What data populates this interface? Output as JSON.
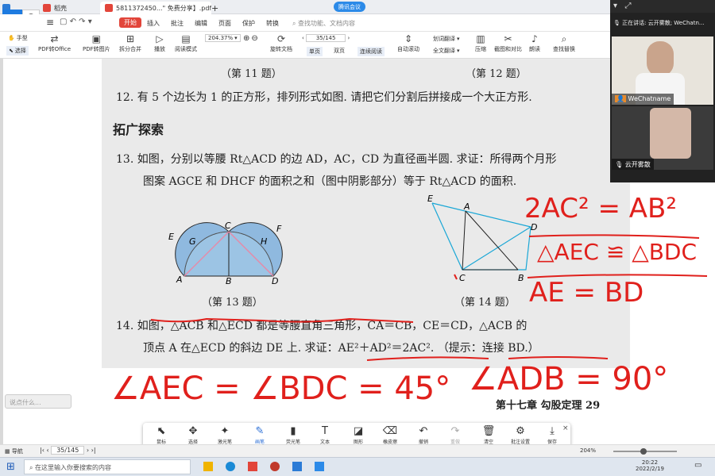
{
  "tabs": [
    {
      "label": "稻壳"
    },
    {
      "label": "5811372450...\" 免费分享】.pdf"
    }
  ],
  "meeting_badge": "腾讯会议",
  "menu": {
    "start": "开始",
    "items": [
      "插入",
      "批注",
      "编辑",
      "页面",
      "保护",
      "转换"
    ],
    "search_placeholder": "查找功能、文档内容"
  },
  "toolbar": {
    "hand": "手型",
    "select": "选择",
    "pdf_office": "PDF转Office",
    "pdf_image": "PDF转图片",
    "split_merge": "拆分合并",
    "play": "播放",
    "read_mode": "阅读模式",
    "zoom": "204.37%",
    "page_box": "35/145",
    "rotate": "旋转文档",
    "single": "单页",
    "double": "双页",
    "continuous": "连续阅读",
    "auto_scroll": "自动滚动",
    "translate": "划词翻译",
    "full_translate": "全文翻译",
    "compress": "压缩",
    "screenshot": "截图和对比",
    "read_aloud": "朗读",
    "find_replace": "查找替换"
  },
  "doc": {
    "cap11": "（第 11 题）",
    "cap12": "（第 12 题）",
    "q12": "12. 有 5 个边长为 1 的正方形，排列形式如图. 请把它们分割后拼接成一个大正方形.",
    "section": "拓广探索",
    "q13a": "13. 如图，分别以等腰 Rt△ACD 的边 AD，AC，CD 为直径画半圆. 求证：所得两个月形",
    "q13b": "图案 AGCE 和 DHCF 的面积之和（图中阴影部分）等于 Rt△ACD 的面积.",
    "cap13": "（第 13 题）",
    "cap14": "（第 14 题）",
    "q14a": "14. 如图，△ACB 和△ECD 都是等腰直角三角形，CA＝CB，CE＝CD，△ACB 的",
    "q14b": "顶点 A 在△ECD 的斜边 DE 上. 求证：AE²＋AD²＝2AC². （提示：连接 BD.）",
    "footer": "第十七章    勾股定理    29",
    "fig13": {
      "E": "E",
      "G": "G",
      "C": "C",
      "H": "H",
      "F": "F",
      "A": "A",
      "B": "B",
      "D": "D"
    },
    "fig14": {
      "E": "E",
      "A": "A",
      "D": "D",
      "C": "C",
      "B": "B"
    }
  },
  "handwriting": {
    "l1": "2AC² = AB²",
    "l2": "△AEC ≌ △BDC",
    "l3": "AE = BD",
    "l4": "∠AEC = ∠BDC = 45°",
    "l5": "∠ADB = 90°"
  },
  "comment_box": "说点什么...",
  "annot": [
    "鼠标",
    "选择",
    "激光笔",
    "画笔",
    "荧光笔",
    "文本",
    "图形",
    "橡皮擦",
    "撤销",
    "重做",
    "清空",
    "批注设置",
    "保存"
  ],
  "status": {
    "nav": "导航",
    "page": "35/145",
    "zoom": "204%"
  },
  "taskbar": {
    "search": "在这里输入你要搜索的内容",
    "time": "20:22",
    "date": "2022/2/19"
  },
  "side": {
    "speaking": "正在讲话: 云开雾散; WeChatn...",
    "name1": "WeChatname",
    "name2": "云开雾散"
  },
  "colors": {
    "accent": "#e2453a",
    "ink": "#e0201c",
    "cyan": "#1aa7d6",
    "pink": "#e58aa8",
    "shade": "#9cc4e4"
  }
}
